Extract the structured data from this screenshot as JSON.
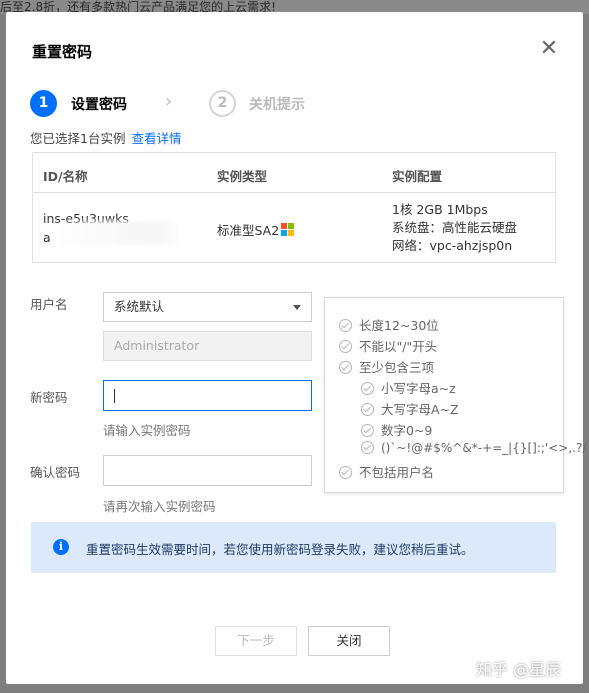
{
  "backdrop": {
    "banner_text": "后至2.8折，还有多款热门云产品满足您的上云需求!"
  },
  "dialog": {
    "title": "重置密码",
    "close_symbol": "✕",
    "steps": [
      {
        "number": "1",
        "label": "设置密码",
        "active": true
      },
      {
        "number": "2",
        "label": "关机提示",
        "active": false
      }
    ],
    "step_separator": "›",
    "selected_text": "您已选择1台实例",
    "view_details_link": "查看详情",
    "instance_table": {
      "headers": [
        "ID/名称",
        "实例类型",
        "实例配置"
      ],
      "rows": [
        {
          "id": "ins-e5u3uwks",
          "name_partial": "a",
          "type": "标准型SA2",
          "config_line1": "1核 2GB 1Mbps",
          "config_line2": "系统盘：高性能云硬盘",
          "config_line3": "网络：vpc-ahzjsp0n"
        }
      ]
    },
    "form": {
      "username_label": "用户名",
      "username_select_value": "系统默认",
      "username_disabled_value": "Administrator",
      "new_password_label": "新密码",
      "new_password_hint": "请输入实例密码",
      "confirm_password_label": "确认密码",
      "confirm_password_hint": "请再次输入实例密码"
    },
    "password_rules": {
      "length": "长度12~30位",
      "no_slash_start": "不能以\"/\"开头",
      "at_least_three": "至少包含三项",
      "lowercase": "小写字母a~z",
      "uppercase": "大写字母A~Z",
      "digits": "数字0~9",
      "special": "()`~!@#$%^&*-+=_|{}[]:;'<>,.?/",
      "no_username": "不包括用户名"
    },
    "info_notice": "重置密码生效需要时间，若您使用新密码登录失败，建议您稍后重试。",
    "buttons": {
      "next": "下一步",
      "close": "关闭"
    }
  },
  "watermark": "知乎 @星辰",
  "colors": {
    "primary": "#006eff",
    "info_bg": "#dbe9fb"
  }
}
